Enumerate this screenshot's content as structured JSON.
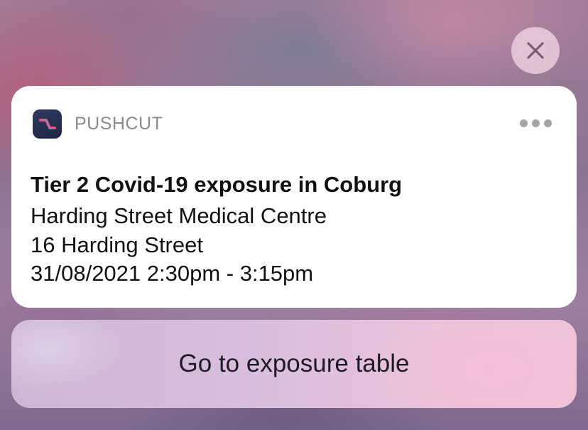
{
  "close_button": {
    "icon": "close-icon"
  },
  "notification": {
    "app": {
      "name": "PUSHCUT",
      "icon": "pushcut-app-icon",
      "icon_colors": [
        "#2f3960",
        "#ec4e73",
        "#5ea0d8"
      ]
    },
    "more_icon": "ellipsis-icon",
    "title": "Tier 2 Covid-19 exposure in Coburg",
    "body_lines": [
      "Harding Street Medical Centre",
      "16 Harding Street",
      "31/08/2021 2:30pm - 3:15pm"
    ]
  },
  "action": {
    "label": "Go to exposure table"
  }
}
